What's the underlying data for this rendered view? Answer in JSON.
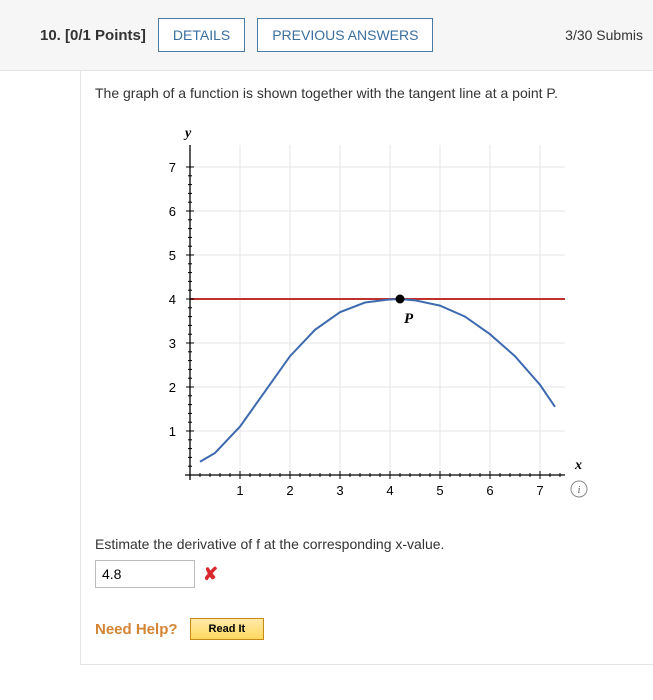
{
  "header": {
    "question_number": "10.",
    "points": "[0/1 Points]",
    "details_label": "DETAILS",
    "previous_label": "PREVIOUS ANSWERS",
    "submissions": "3/30 Submis"
  },
  "body": {
    "prompt": "The graph of a function is shown together with the tangent line at a point P.",
    "question": "Estimate the derivative of f at the corresponding x-value.",
    "answer_value": "4.8",
    "need_help_label": "Need Help?",
    "read_it_label": "Read It"
  },
  "chart_data": {
    "type": "line",
    "title": "",
    "xlabel": "x",
    "ylabel": "y",
    "xlim": [
      0,
      7.5
    ],
    "ylim": [
      0,
      7.5
    ],
    "x_ticks": [
      1,
      2,
      3,
      4,
      5,
      6,
      7
    ],
    "y_ticks": [
      1,
      2,
      3,
      4,
      5,
      6,
      7
    ],
    "series": [
      {
        "name": "tangent",
        "color": "#c0302e",
        "x": [
          0,
          7.5
        ],
        "y": [
          4,
          4
        ]
      },
      {
        "name": "f",
        "color": "#3d6aaf",
        "x": [
          0.2,
          0.5,
          1.0,
          1.5,
          2.0,
          2.5,
          3.0,
          3.5,
          4.0,
          4.2,
          4.5,
          5.0,
          5.5,
          6.0,
          6.5,
          7.0,
          7.3
        ],
        "y": [
          0.3,
          0.5,
          1.1,
          1.9,
          2.7,
          3.3,
          3.7,
          3.92,
          3.99,
          4.0,
          3.97,
          3.85,
          3.6,
          3.2,
          2.7,
          2.05,
          1.55
        ]
      }
    ],
    "point": {
      "name": "P",
      "x": 4.2,
      "y": 4.0
    },
    "derivative_at_P": 0
  }
}
